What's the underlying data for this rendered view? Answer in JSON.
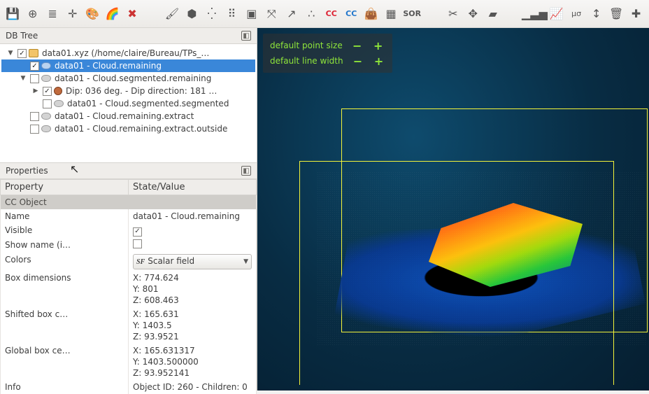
{
  "toolbar_icons": [
    "disk",
    "target",
    "list",
    "crosshair",
    "palette",
    "rainbow",
    "delete-x",
    "blank",
    "brush",
    "shield",
    "dots",
    "grid-dots",
    "cube",
    "arrows-cross",
    "arrows-sw",
    "graph-dots",
    "cc-red",
    "cc-blue",
    "bag",
    "checker",
    "sor",
    "blank",
    "scissors",
    "axes-color",
    "book-red",
    "blank",
    "bars",
    "bars-up",
    "sigma",
    "minmax",
    "trash-rainbow",
    "plus"
  ],
  "panels": {
    "dbtree_title": "DB Tree",
    "properties_title": "Properties"
  },
  "tree": [
    {
      "depth": 0,
      "twisty": "down",
      "checked": true,
      "icon": "folder",
      "label": "data01.xyz (/home/claire/Bureau/TPs_…",
      "selected": false
    },
    {
      "depth": 1,
      "twisty": "",
      "checked": true,
      "icon": "cloud-blue",
      "label": "data01 - Cloud.remaining",
      "selected": true
    },
    {
      "depth": 1,
      "twisty": "down",
      "checked": false,
      "icon": "cloud",
      "label": "data01 - Cloud.segmented.remaining",
      "selected": false
    },
    {
      "depth": 2,
      "twisty": "right",
      "checked": true,
      "icon": "geo",
      "label": "Dip: 036 deg. - Dip direction: 181 …",
      "selected": false
    },
    {
      "depth": 2,
      "twisty": "",
      "checked": false,
      "icon": "cloud",
      "label": "data01 - Cloud.segmented.segmented",
      "selected": false
    },
    {
      "depth": 1,
      "twisty": "",
      "checked": false,
      "icon": "cloud",
      "label": "data01 - Cloud.remaining.extract",
      "selected": false
    },
    {
      "depth": 1,
      "twisty": "",
      "checked": false,
      "icon": "cloud",
      "label": "data01 - Cloud.remaining.extract.outside",
      "selected": false
    }
  ],
  "properties": {
    "headers": {
      "property": "Property",
      "value": "State/Value"
    },
    "section_label": "CC Object",
    "rows": [
      {
        "k": "Name",
        "type": "text",
        "v": "data01 - Cloud.remaining"
      },
      {
        "k": "Visible",
        "type": "checkbox",
        "v": true
      },
      {
        "k": "Show name (i…",
        "type": "checkbox",
        "v": false
      },
      {
        "k": "Colors",
        "type": "combo",
        "v": "Scalar field"
      },
      {
        "k": "Box dimensions",
        "type": "multi",
        "v": "X: 774.624\nY: 801\nZ: 608.463"
      },
      {
        "k": "Shifted box c…",
        "type": "multi",
        "v": "X: 165.631\nY: 1403.5\nZ: 93.9521"
      },
      {
        "k": "Global box ce…",
        "type": "multi",
        "v": "X: 165.631317\nY: 1403.500000\nZ: 93.952141"
      },
      {
        "k": "Info",
        "type": "text",
        "v": "Object ID: 260 - Children: 0"
      }
    ]
  },
  "viewport_overlay": {
    "row1": "default point size",
    "row2": "default line width"
  }
}
